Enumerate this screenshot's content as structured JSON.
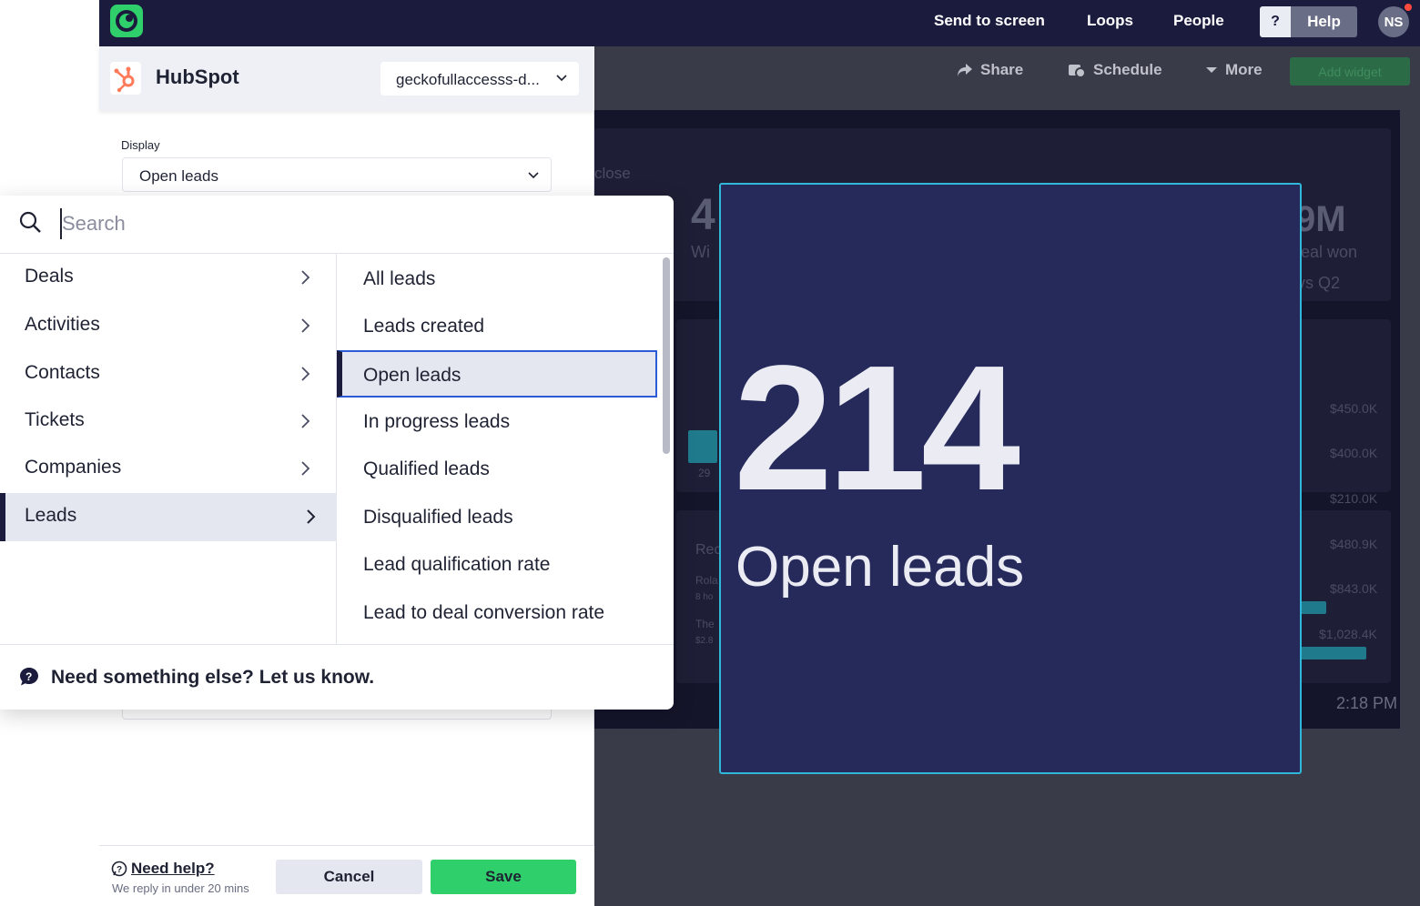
{
  "topbar": {
    "nav": [
      "Send to screen",
      "Loops",
      "People"
    ],
    "help_q": "?",
    "help_label": "Help",
    "avatar_initials": "NS"
  },
  "dashboard": {
    "toolbar": {
      "share": "Share",
      "schedule": "Schedule",
      "more": "More",
      "add_widget": "Add widget"
    },
    "ghost_texts": {
      "close": "close",
      "win": "Wi",
      "m_suffix": "9M",
      "deal_won": "eal won",
      "vs_q2": "vs Q2",
      "num29": "29",
      "rec": "Rec",
      "role": "Rola",
      "hours": "8 ho",
      "the": "The",
      "amt": "$2.8"
    },
    "values": [
      "$450.0K",
      "$400.0K",
      "$210.0K",
      "$480.9K",
      "$843.0K",
      "$1,028.4K"
    ],
    "time": "2:18 PM"
  },
  "widget": {
    "value": "214",
    "label": "Open leads"
  },
  "panel": {
    "title": "HubSpot",
    "account": "geckofullaccesss-d...",
    "display_label": "Display",
    "display_value": "Open leads",
    "footer": {
      "need_help": "Need help?",
      "reply": "We reply in under 20 mins",
      "cancel": "Cancel",
      "save": "Save"
    }
  },
  "popover": {
    "search_placeholder": "Search",
    "categories": [
      "Deals",
      "Activities",
      "Contacts",
      "Tickets",
      "Companies",
      "Leads"
    ],
    "active_category": "Leads",
    "options": [
      "All leads",
      "Leads created",
      "Open leads",
      "In progress leads",
      "Qualified leads",
      "Disqualified leads",
      "Lead qualification rate",
      "Lead to deal conversion rate"
    ],
    "active_option": "Open leads",
    "footer_msg": "Need something else? Let us know."
  },
  "colors": {
    "brand_green": "#2fd06b",
    "topbar": "#1b1c3d",
    "widget_bg": "#262a5b",
    "widget_border": "#2fb8d9",
    "hubspot_orange": "#ff7a59",
    "selection_border": "#2b5bd6"
  }
}
